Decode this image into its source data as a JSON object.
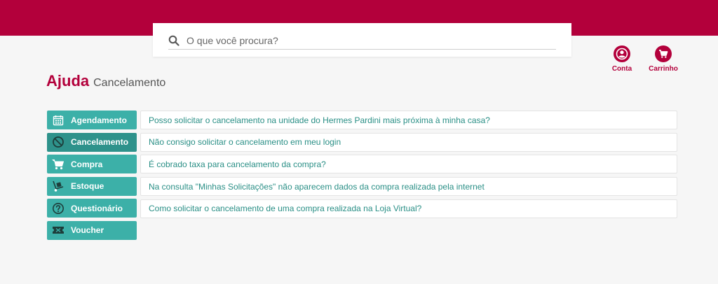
{
  "search": {
    "placeholder": "O que você procura?"
  },
  "header": {
    "account_label": "Conta",
    "cart_label": "Carrinho"
  },
  "page": {
    "title": "Ajuda",
    "subtitle": "Cancelamento"
  },
  "sidebar": {
    "items": [
      {
        "label": "Agendamento",
        "icon": "calendar-icon"
      },
      {
        "label": "Cancelamento",
        "icon": "cancel-icon",
        "active": true
      },
      {
        "label": "Compra",
        "icon": "cart-icon"
      },
      {
        "label": "Estoque",
        "icon": "hand-truck-icon"
      },
      {
        "label": "Questionário",
        "icon": "question-icon"
      },
      {
        "label": "Voucher",
        "icon": "ticket-icon"
      }
    ]
  },
  "faq": {
    "questions": [
      "Posso solicitar o cancelamento na unidade do Hermes Pardini mais próxima à minha casa?",
      "Não consigo solicitar o cancelamento em meu login",
      "É cobrado taxa para cancelamento da compra?",
      "Na consulta \"Minhas Solicitações\" não aparecem dados da compra realizada pela internet",
      "Como solicitar o cancelamento de uma compra realizada na Loja Virtual?"
    ]
  },
  "colors": {
    "brand": "#b3003b",
    "teal": "#3cb0a8",
    "teal_active": "#2e928b",
    "link": "#2a8f86"
  }
}
